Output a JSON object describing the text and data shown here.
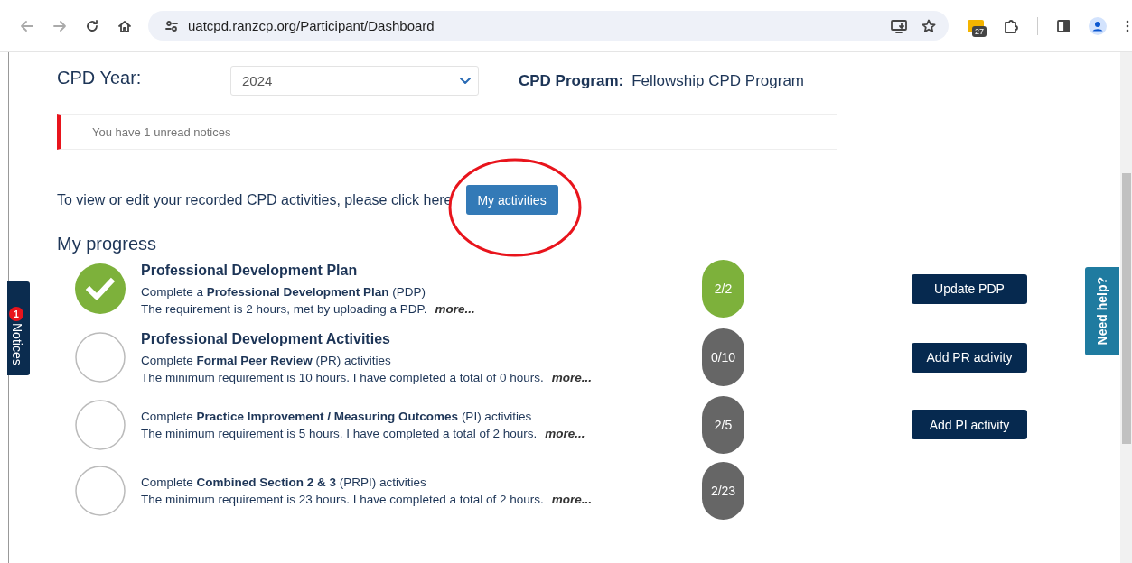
{
  "browser": {
    "url": "uatcpd.ranzcp.org/Participant/Dashboard",
    "extension_badge": "27"
  },
  "cpd_year": {
    "label": "CPD Year:",
    "value": "2024"
  },
  "cpd_program": {
    "label": "CPD Program:",
    "value": "Fellowship CPD Program"
  },
  "notice": "You have 1 unread notices",
  "instruction": "To view or edit your recorded CPD activities, please click here",
  "my_activities_button": "My activities",
  "progress_heading": "My progress",
  "sections": [
    {
      "title": "Professional Development Plan",
      "items": [
        {
          "complete": true,
          "description": "Complete a **Professional Development Plan** (PDP)",
          "note": "The requirement is 2 hours, met by uploading a PDP.",
          "more": "more...",
          "count": "2/2",
          "button": "Update PDP"
        }
      ]
    },
    {
      "title": "Professional Development Activities",
      "items": [
        {
          "complete": false,
          "description": "Complete **Formal Peer Review** (PR) activities",
          "note": "The minimum requirement is 10 hours. I have completed a total of 0 hours.",
          "more": "more...",
          "count": "0/10",
          "button": "Add PR activity"
        },
        {
          "complete": false,
          "description": "Complete **Practice Improvement / Measuring Outcomes** (PI) activities",
          "note": "The minimum requirement is 5 hours. I have completed a total of 2 hours.",
          "more": "more...",
          "count": "2/5",
          "button": "Add PI activity"
        },
        {
          "complete": false,
          "description": "Complete **Combined Section 2 & 3** (PRPI) activities",
          "note": "The minimum requirement is 23 hours. I have completed a total of 2 hours.",
          "more": "more...",
          "count": "2/23"
        }
      ]
    }
  ],
  "notices_tab": {
    "label": "Notices",
    "badge": "1"
  },
  "help_tab": "Need help?"
}
